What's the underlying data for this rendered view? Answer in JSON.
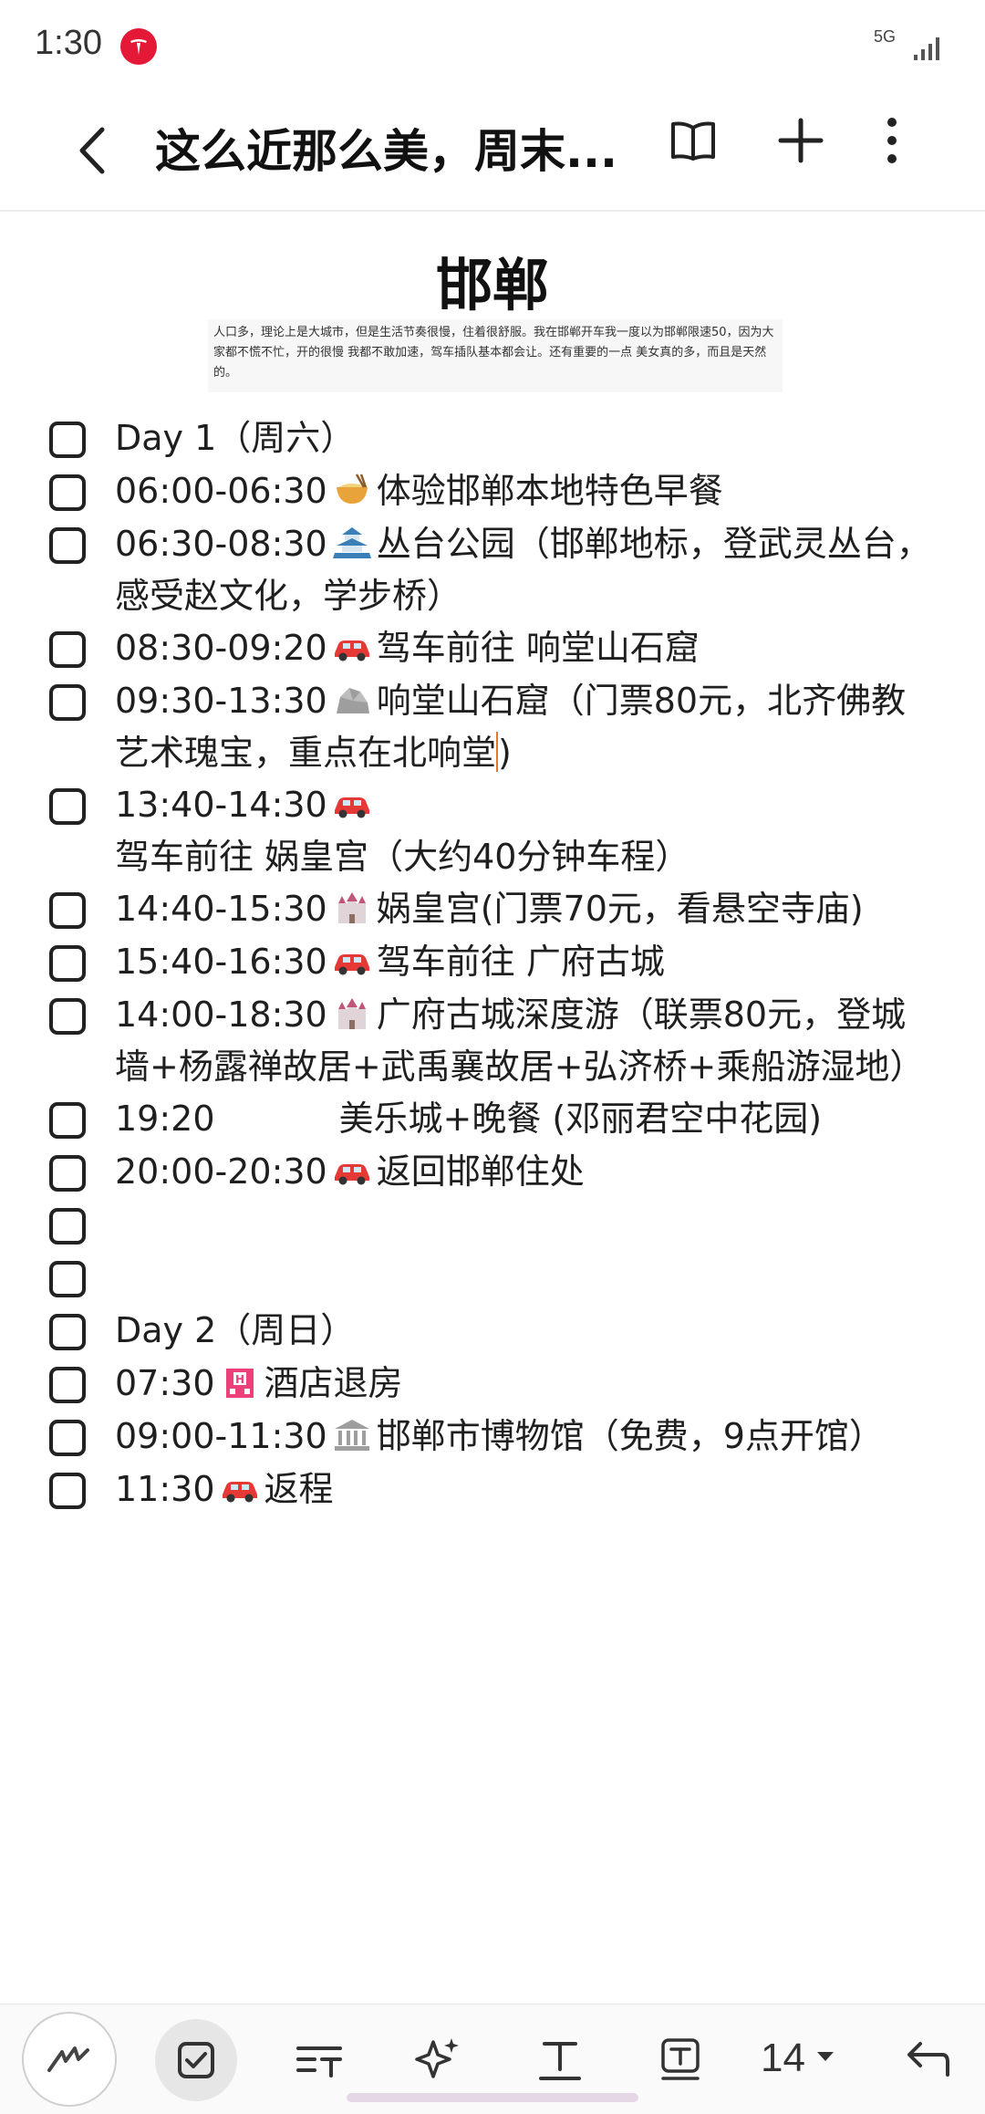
{
  "status": {
    "time": "1:30",
    "network": "5G"
  },
  "header": {
    "title": "这么近那么美，周末..."
  },
  "note": {
    "title": "邯郸",
    "quote": "人口多，理论上是大城市，但是生活节奏很慢，住着很舒服。我在邯郸开车我一度以为邯郸限速50，因为大家都不慌不忙，开的很慢 我都不敢加速，驾车插队基本都会让。还有重要的一点 美女真的多，而且是天然的。"
  },
  "items": [
    {
      "text": " Day 1（周六）"
    },
    {
      "time": "06:00-06:30",
      "emoji": "noodle-bowl-icon",
      "text": "体验邯郸本地特色早餐"
    },
    {
      "time": "06:30-08:30",
      "emoji": "pagoda-icon",
      "text": "丛台公园（邯郸地标，登武灵丛台，感受赵文化，学步桥）"
    },
    {
      "time": "08:30-09:20",
      "emoji": "car-icon",
      "text": "驾车前往 响堂山石窟"
    },
    {
      "time": "09:30-13:30",
      "emoji": "rock-icon",
      "text": "响堂山石窟（门票80元，北齐佛教艺术瑰宝，重点在北响堂",
      "after": ")"
    },
    {
      "time": "13:40-14:30",
      "emoji": "car-icon",
      "text": "驾车前往 娲皇宫（大约40分钟车程）"
    },
    {
      "time": "14:40-15:30",
      "emoji": "castle-icon",
      "text": "娲皇宫(门票70元，看悬空寺庙)"
    },
    {
      "time": "15:40-16:30",
      "emoji": "car-icon",
      "text": "驾车前往 广府古城"
    },
    {
      "time": "14:00-18:30",
      "emoji": "castle-icon",
      "text": "广府古城深度游（联票80元，登城墙+杨露禅故居+武禹襄故居+弘济桥+乘船游湿地）"
    },
    {
      "time": "19:20",
      "text": "美乐城+晚餐 (邓丽君空中花园)"
    },
    {
      "time": "20:00-20:30",
      "emoji": "car-icon",
      "text": "返回邯郸住处"
    },
    {
      "text": ""
    },
    {
      "text": ""
    },
    {
      "text": "Day 2（周日）"
    },
    {
      "time": "07:30",
      "emoji": "hotel-icon",
      "text": "酒店退房"
    },
    {
      "time": "09:00-11:30",
      "emoji": "museum-icon",
      "text": "邯郸市博物馆（免费，9点开馆）"
    },
    {
      "time": "11:30",
      "emoji": "car-icon",
      "text": "返程"
    }
  ],
  "toolbar": {
    "font_size": "14"
  }
}
